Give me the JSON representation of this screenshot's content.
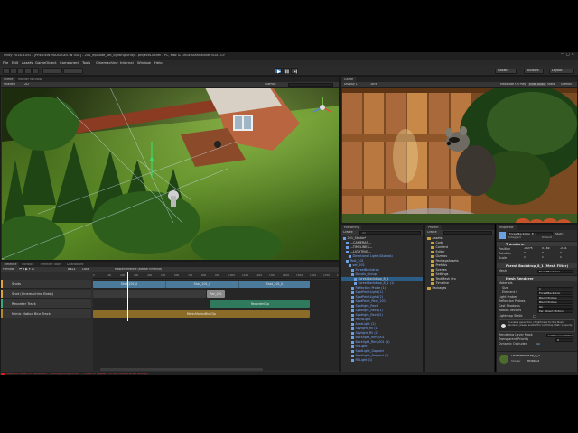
{
  "window": {
    "title": "Unity 2018.3.8f1 - [PREVIEW PACKAGES IN USE] - 201_episode_set_lighting.unity - projects-lionel - PC, Mac & Linux Standalone <DX11>"
  },
  "menu": [
    "File",
    "Edit",
    "Assets",
    "GameObject",
    "Component",
    "Tools",
    "Cinemachine",
    "Internal",
    "Window",
    "Help"
  ],
  "toolbar": {
    "collab_label": "Collab",
    "account_label": "Account",
    "layers_label": "Layers",
    "layout_label": "Layout"
  },
  "scene": {
    "tab_scene": "Scene",
    "tab_render": "Render Window",
    "shading_mode": "Shaded",
    "mode_2d": "2D",
    "gizmos_label": "Gizmos"
  },
  "game": {
    "tab_game": "Game",
    "display": "Display 1",
    "aspect": "16:9",
    "maximize": "Maximize On Play",
    "mute": "Mute Audio",
    "stats": "Stats",
    "gizmos_label": "Gizmos"
  },
  "hierarchy": {
    "tab": "Hierarchy",
    "create": "Create",
    "search_placeholder": "All",
    "items": [
      {
        "label": "201_Studio*",
        "color": "white",
        "indent": 0,
        "sel": false
      },
      {
        "label": "---CAMERAS---",
        "color": "white",
        "indent": 1,
        "sel": false
      },
      {
        "label": "---TIMELINES---",
        "color": "white",
        "indent": 1,
        "sel": false
      },
      {
        "label": "---LIGHTING---",
        "color": "white",
        "indent": 1,
        "sel": false
      },
      {
        "label": "Directional Light (Globals)",
        "color": "blue",
        "indent": 2,
        "sel": false
      },
      {
        "label": "Post_201",
        "color": "blue",
        "indent": 1,
        "sel": false
      },
      {
        "label": "set_201",
        "color": "blue",
        "indent": 2,
        "sel": false
      },
      {
        "label": "ForestBackdrop",
        "color": "blue",
        "indent": 3,
        "sel": false
      },
      {
        "label": "Decals_Group",
        "color": "blue",
        "indent": 3,
        "sel": false
      },
      {
        "label": "ForestBackdrop_8_1",
        "color": "white",
        "indent": 4,
        "sel": true
      },
      {
        "label": "ForestBackdrop_8_1 (1)",
        "color": "blue",
        "indent": 4,
        "sel": false
      },
      {
        "label": "Reflection Probe (1)",
        "color": "blue",
        "indent": 3,
        "sel": false
      },
      {
        "label": "SpotPointLight (1)",
        "color": "blue",
        "indent": 3,
        "sel": false
      },
      {
        "label": "SpotPointLight (2)",
        "color": "blue",
        "indent": 3,
        "sel": false
      },
      {
        "label": "SpotPoint_Rect_201",
        "color": "blue",
        "indent": 3,
        "sel": false
      },
      {
        "label": "Spotlight_Rect",
        "color": "blue",
        "indent": 3,
        "sel": false
      },
      {
        "label": "Spotlight_Rect (1)",
        "color": "blue",
        "indent": 3,
        "sel": false
      },
      {
        "label": "Spotlight_Rect (2)",
        "color": "blue",
        "indent": 3,
        "sel": false
      },
      {
        "label": "PointLight",
        "color": "blue",
        "indent": 3,
        "sel": false
      },
      {
        "label": "AreaLight (1)",
        "color": "blue",
        "indent": 3,
        "sel": false
      },
      {
        "label": "Skylight_Fill (1)",
        "color": "blue",
        "indent": 3,
        "sel": false
      },
      {
        "label": "Skylight_Fill (2)",
        "color": "blue",
        "indent": 3,
        "sel": false
      },
      {
        "label": "Backlight_Rim_001",
        "color": "blue",
        "indent": 3,
        "sel": false
      },
      {
        "label": "Backlight_Rim_001 (1)",
        "color": "blue",
        "indent": 3,
        "sel": false
      },
      {
        "label": "FillLight",
        "color": "blue",
        "indent": 3,
        "sel": false
      },
      {
        "label": "SpotLight_Gapped",
        "color": "blue",
        "indent": 3,
        "sel": false
      },
      {
        "label": "SpotLight_Gapped (1)",
        "color": "blue",
        "indent": 3,
        "sel": false
      },
      {
        "label": "FillLight (1)",
        "color": "blue",
        "indent": 3,
        "sel": false
      }
    ]
  },
  "project": {
    "tab": "Project",
    "create": "Create",
    "items": [
      {
        "label": "Assets",
        "indent": 0
      },
      {
        "label": "Code",
        "indent": 1
      },
      {
        "label": "Content",
        "indent": 1
      },
      {
        "label": "Editor",
        "indent": 1
      },
      {
        "label": "Gizmos",
        "indent": 1
      },
      {
        "label": "PackageAssets",
        "indent": 1
      },
      {
        "label": "Prefabs",
        "indent": 1
      },
      {
        "label": "Scenes",
        "indent": 1
      },
      {
        "label": "Settings",
        "indent": 1
      },
      {
        "label": "TextMesh Pro",
        "indent": 1
      },
      {
        "label": "Timeline",
        "indent": 1
      },
      {
        "label": "Packages",
        "indent": 0
      }
    ]
  },
  "inspector": {
    "tab": "Inspector",
    "object_name": "ForestBackdrop_8_1",
    "tag": "Untagged",
    "layer": "Default",
    "static": "Static",
    "transform_header": "Transform",
    "position_label": "Position",
    "position": {
      "x": "-0.275",
      "y": "0.169",
      "z": "-2.51"
    },
    "rotation_label": "Rotation",
    "rotation": {
      "x": "0",
      "y": "0",
      "z": "0"
    },
    "scale_label": "Scale",
    "scale": {
      "x": "1",
      "y": "1",
      "z": "1"
    },
    "mesh_filter_header": "Forest Backdrop_8_1 (Mesh Filter)",
    "mesh_label": "Mesh",
    "mesh_value": "ForestBackdrop",
    "renderer_header": "Mesh Renderer",
    "materials_label": "Materials",
    "size_label": "Size",
    "size_value": "1",
    "element0_label": "Element 0",
    "element0_value": "ForestBackdrop",
    "light_probes_label": "Light Probes",
    "light_probes_value": "Blend Probes",
    "reflection_probes_label": "Reflection Probes",
    "reflection_probes_value": "Blend Probes",
    "cast_shadows_label": "Cast Shadows",
    "cast_shadows_value": "On",
    "motion_vectors_label": "Motion Vectors",
    "motion_vectors_value": "Per Object Motion",
    "lightmap_static_label": "Lightmap Static",
    "info_text": "To enable generation of lightmaps for this Mesh Renderer, please enable the 'Lightmap Static' property.",
    "rendering_layer_label": "Rendering Layer Mask",
    "rendering_layer_value": "Light Layer default",
    "transparent_priority_label": "Transparent Priority",
    "transparent_priority_value": "0",
    "dynamic_occlusion_label": "Dynamic Occluded",
    "material_name": "ForestBackdrop_8_1",
    "shader_label": "Shader",
    "shader_value": "HDRP/Lit"
  },
  "timeline": {
    "tab_timeline": "Timeline",
    "tab_console": "Console",
    "tab_tools": "Timeline Tools",
    "tab_dashboard": "Dashboard",
    "preview_label": "Preview",
    "frame": "0311",
    "local_label": "Local",
    "asset_name": "MasterTimeline (MasterTimeline)",
    "ticks": [
      "0",
      "100",
      "200",
      "300",
      "400",
      "500",
      "600",
      "700",
      "800",
      "900",
      "1000",
      "1100",
      "1200",
      "1300",
      "1400",
      "1500",
      "1600",
      "1700",
      "1800"
    ],
    "tracks": [
      {
        "name": "Shots",
        "color": "#e2a23b"
      },
      {
        "name": "Shot (Cinemachine Brain)",
        "color": "#e2a23b"
      },
      {
        "name": "Recorder Track",
        "color": "#3aa87a"
      },
      {
        "name": "Mimic Motion Blur Track",
        "color": "#b5892d"
      }
    ],
    "shots": [
      "Shot_201_0",
      "Shot_201_0",
      "Shot_201_0"
    ],
    "shot_extra": "Rec_201",
    "recorder_clip": "RecorderClip",
    "blur_clip": "MimicMotionBlurClip"
  },
  "status": {
    "message": "Assertion failed on expression: 'IsUsingSpotLightColor' - This error appears on the console when editing ..."
  },
  "colors": {
    "accent_blue": "#3a6ea5",
    "selection": "#2c5d87",
    "error": "#d02020"
  }
}
